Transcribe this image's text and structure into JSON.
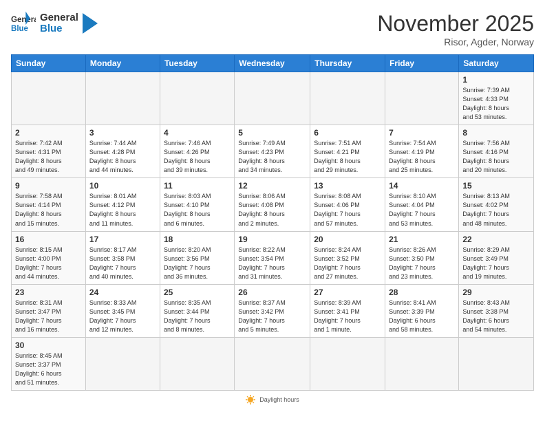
{
  "header": {
    "logo_general": "General",
    "logo_blue": "Blue",
    "month": "November 2025",
    "location": "Risor, Agder, Norway"
  },
  "days_of_week": [
    "Sunday",
    "Monday",
    "Tuesday",
    "Wednesday",
    "Thursday",
    "Friday",
    "Saturday"
  ],
  "weeks": [
    [
      {
        "day": "",
        "info": ""
      },
      {
        "day": "",
        "info": ""
      },
      {
        "day": "",
        "info": ""
      },
      {
        "day": "",
        "info": ""
      },
      {
        "day": "",
        "info": ""
      },
      {
        "day": "",
        "info": ""
      },
      {
        "day": "1",
        "info": "Sunrise: 7:39 AM\nSunset: 4:33 PM\nDaylight: 8 hours\nand 53 minutes."
      }
    ],
    [
      {
        "day": "2",
        "info": "Sunrise: 7:42 AM\nSunset: 4:31 PM\nDaylight: 8 hours\nand 49 minutes."
      },
      {
        "day": "3",
        "info": "Sunrise: 7:44 AM\nSunset: 4:28 PM\nDaylight: 8 hours\nand 44 minutes."
      },
      {
        "day": "4",
        "info": "Sunrise: 7:46 AM\nSunset: 4:26 PM\nDaylight: 8 hours\nand 39 minutes."
      },
      {
        "day": "5",
        "info": "Sunrise: 7:49 AM\nSunset: 4:23 PM\nDaylight: 8 hours\nand 34 minutes."
      },
      {
        "day": "6",
        "info": "Sunrise: 7:51 AM\nSunset: 4:21 PM\nDaylight: 8 hours\nand 29 minutes."
      },
      {
        "day": "7",
        "info": "Sunrise: 7:54 AM\nSunset: 4:19 PM\nDaylight: 8 hours\nand 25 minutes."
      },
      {
        "day": "8",
        "info": "Sunrise: 7:56 AM\nSunset: 4:16 PM\nDaylight: 8 hours\nand 20 minutes."
      }
    ],
    [
      {
        "day": "9",
        "info": "Sunrise: 7:58 AM\nSunset: 4:14 PM\nDaylight: 8 hours\nand 15 minutes."
      },
      {
        "day": "10",
        "info": "Sunrise: 8:01 AM\nSunset: 4:12 PM\nDaylight: 8 hours\nand 11 minutes."
      },
      {
        "day": "11",
        "info": "Sunrise: 8:03 AM\nSunset: 4:10 PM\nDaylight: 8 hours\nand 6 minutes."
      },
      {
        "day": "12",
        "info": "Sunrise: 8:06 AM\nSunset: 4:08 PM\nDaylight: 8 hours\nand 2 minutes."
      },
      {
        "day": "13",
        "info": "Sunrise: 8:08 AM\nSunset: 4:06 PM\nDaylight: 7 hours\nand 57 minutes."
      },
      {
        "day": "14",
        "info": "Sunrise: 8:10 AM\nSunset: 4:04 PM\nDaylight: 7 hours\nand 53 minutes."
      },
      {
        "day": "15",
        "info": "Sunrise: 8:13 AM\nSunset: 4:02 PM\nDaylight: 7 hours\nand 48 minutes."
      }
    ],
    [
      {
        "day": "16",
        "info": "Sunrise: 8:15 AM\nSunset: 4:00 PM\nDaylight: 7 hours\nand 44 minutes."
      },
      {
        "day": "17",
        "info": "Sunrise: 8:17 AM\nSunset: 3:58 PM\nDaylight: 7 hours\nand 40 minutes."
      },
      {
        "day": "18",
        "info": "Sunrise: 8:20 AM\nSunset: 3:56 PM\nDaylight: 7 hours\nand 36 minutes."
      },
      {
        "day": "19",
        "info": "Sunrise: 8:22 AM\nSunset: 3:54 PM\nDaylight: 7 hours\nand 31 minutes."
      },
      {
        "day": "20",
        "info": "Sunrise: 8:24 AM\nSunset: 3:52 PM\nDaylight: 7 hours\nand 27 minutes."
      },
      {
        "day": "21",
        "info": "Sunrise: 8:26 AM\nSunset: 3:50 PM\nDaylight: 7 hours\nand 23 minutes."
      },
      {
        "day": "22",
        "info": "Sunrise: 8:29 AM\nSunset: 3:49 PM\nDaylight: 7 hours\nand 19 minutes."
      }
    ],
    [
      {
        "day": "23",
        "info": "Sunrise: 8:31 AM\nSunset: 3:47 PM\nDaylight: 7 hours\nand 16 minutes."
      },
      {
        "day": "24",
        "info": "Sunrise: 8:33 AM\nSunset: 3:45 PM\nDaylight: 7 hours\nand 12 minutes."
      },
      {
        "day": "25",
        "info": "Sunrise: 8:35 AM\nSunset: 3:44 PM\nDaylight: 7 hours\nand 8 minutes."
      },
      {
        "day": "26",
        "info": "Sunrise: 8:37 AM\nSunset: 3:42 PM\nDaylight: 7 hours\nand 5 minutes."
      },
      {
        "day": "27",
        "info": "Sunrise: 8:39 AM\nSunset: 3:41 PM\nDaylight: 7 hours\nand 1 minute."
      },
      {
        "day": "28",
        "info": "Sunrise: 8:41 AM\nSunset: 3:39 PM\nDaylight: 6 hours\nand 58 minutes."
      },
      {
        "day": "29",
        "info": "Sunrise: 8:43 AM\nSunset: 3:38 PM\nDaylight: 6 hours\nand 54 minutes."
      }
    ],
    [
      {
        "day": "30",
        "info": "Sunrise: 8:45 AM\nSunset: 3:37 PM\nDaylight: 6 hours\nand 51 minutes."
      },
      {
        "day": "",
        "info": ""
      },
      {
        "day": "",
        "info": ""
      },
      {
        "day": "",
        "info": ""
      },
      {
        "day": "",
        "info": ""
      },
      {
        "day": "",
        "info": ""
      },
      {
        "day": "",
        "info": ""
      }
    ]
  ],
  "footer": {
    "daylight_label": "Daylight hours"
  }
}
